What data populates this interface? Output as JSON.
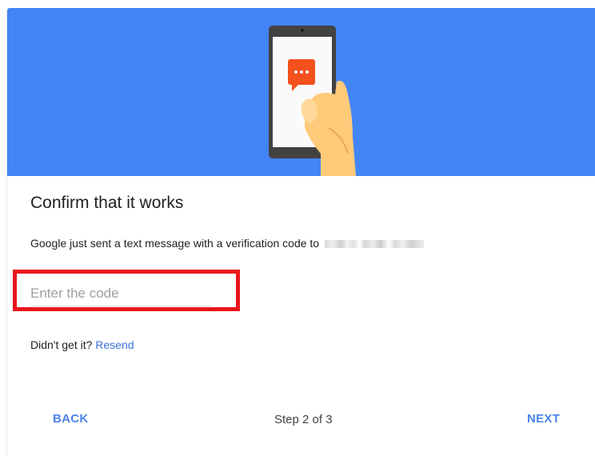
{
  "hero": {
    "illustration": "phone-with-message-icon",
    "background_color": "#4285f4"
  },
  "content": {
    "title": "Confirm that it works",
    "description": "Google just sent a text message with a verification code to",
    "phone_number_redacted": true
  },
  "code_field": {
    "placeholder": "Enter the code",
    "value": ""
  },
  "resend": {
    "prompt": "Didn't get it?",
    "link_label": "Resend"
  },
  "footer": {
    "back_label": "BACK",
    "step_text": "Step 2 of 3",
    "next_label": "NEXT"
  },
  "colors": {
    "accent": "#4a83e8",
    "highlight": "#e8151c"
  }
}
